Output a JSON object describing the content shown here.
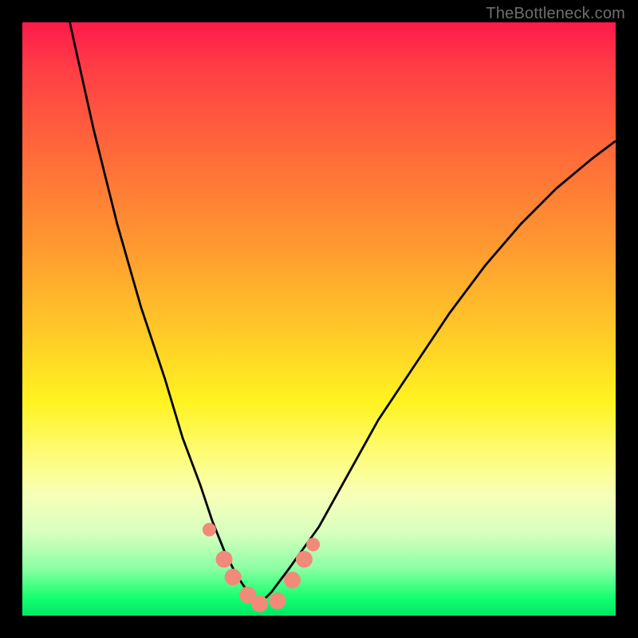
{
  "watermark": "TheBottleneck.com",
  "chart_data": {
    "type": "line",
    "title": "",
    "xlabel": "",
    "ylabel": "",
    "xlim": [
      0,
      1
    ],
    "ylim": [
      0,
      1
    ],
    "series": [
      {
        "name": "curve",
        "x": [
          0.08,
          0.12,
          0.16,
          0.2,
          0.24,
          0.27,
          0.3,
          0.32,
          0.34,
          0.36,
          0.38,
          0.4,
          0.42,
          0.45,
          0.5,
          0.55,
          0.6,
          0.66,
          0.72,
          0.78,
          0.84,
          0.9,
          0.96,
          1.0
        ],
        "y": [
          1.0,
          0.82,
          0.66,
          0.52,
          0.4,
          0.3,
          0.22,
          0.16,
          0.11,
          0.07,
          0.04,
          0.02,
          0.04,
          0.08,
          0.15,
          0.24,
          0.33,
          0.42,
          0.51,
          0.59,
          0.66,
          0.72,
          0.77,
          0.8
        ]
      }
    ],
    "markers": [
      {
        "x": 0.315,
        "y": 0.145,
        "r": 8
      },
      {
        "x": 0.34,
        "y": 0.095,
        "r": 10
      },
      {
        "x": 0.355,
        "y": 0.065,
        "r": 10
      },
      {
        "x": 0.38,
        "y": 0.035,
        "r": 10
      },
      {
        "x": 0.4,
        "y": 0.02,
        "r": 10
      },
      {
        "x": 0.43,
        "y": 0.025,
        "r": 10
      },
      {
        "x": 0.455,
        "y": 0.06,
        "r": 10
      },
      {
        "x": 0.475,
        "y": 0.095,
        "r": 10
      },
      {
        "x": 0.49,
        "y": 0.12,
        "r": 8
      }
    ]
  }
}
